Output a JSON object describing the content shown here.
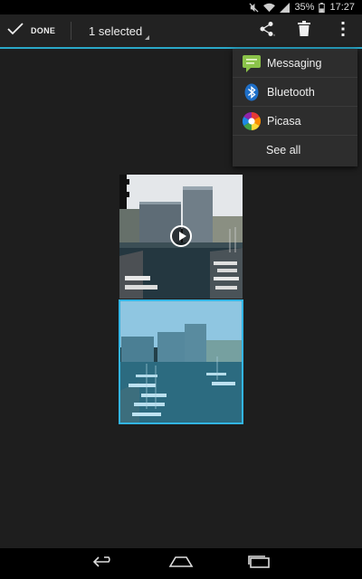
{
  "status": {
    "battery_percent": "35%",
    "time": "17:27"
  },
  "actionbar": {
    "done_label": "DONE",
    "selection_label": "1 selected"
  },
  "share_menu": {
    "items": [
      {
        "label": "Messaging",
        "icon": "messaging-icon"
      },
      {
        "label": "Bluetooth",
        "icon": "bluetooth-icon"
      },
      {
        "label": "Picasa",
        "icon": "picasa-icon"
      },
      {
        "label": "See all"
      }
    ]
  },
  "gallery": {
    "items": [
      {
        "type": "video",
        "selected": false
      },
      {
        "type": "photo",
        "selected": true
      }
    ]
  },
  "colors": {
    "accent": "#33b5e5",
    "background": "#1e1e1e",
    "actionbar": "#222222"
  }
}
